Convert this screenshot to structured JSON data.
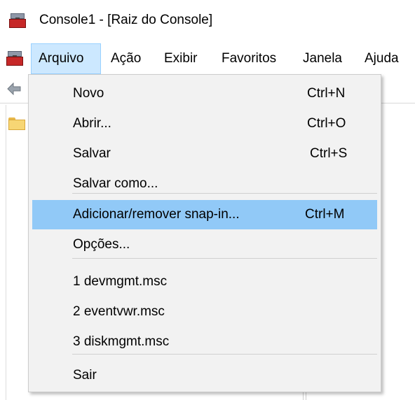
{
  "window": {
    "title": "Console1 - [Raiz do Console]"
  },
  "icons": {
    "app": "toolbox-icon",
    "back": "back-arrow-icon",
    "folder": "folder-icon"
  },
  "menubar": {
    "items": [
      {
        "label": "Arquivo",
        "active": true
      },
      {
        "label": "Ação"
      },
      {
        "label": "Exibir"
      },
      {
        "label": "Favoritos"
      },
      {
        "label": "Janela"
      },
      {
        "label": "Ajuda"
      }
    ]
  },
  "dropdown": {
    "items": [
      {
        "label": "Novo",
        "shortcut": "Ctrl+N"
      },
      {
        "label": "Abrir...",
        "shortcut": "Ctrl+O"
      },
      {
        "label": "Salvar",
        "shortcut": "Ctrl+S"
      },
      {
        "label": "Salvar como...",
        "shortcut": ""
      },
      {
        "label": "Adicionar/remover snap-in...",
        "shortcut": "Ctrl+M",
        "highlighted": true
      },
      {
        "label": "Opções...",
        "shortcut": ""
      },
      {
        "label": "1 devmgmt.msc",
        "shortcut": ""
      },
      {
        "label": "2 eventvwr.msc",
        "shortcut": ""
      },
      {
        "label": "3 diskmgmt.msc",
        "shortcut": ""
      },
      {
        "label": "Sair",
        "shortcut": ""
      }
    ]
  },
  "colors": {
    "highlight": "#91c9f7",
    "menu_active": "#cce8ff",
    "menu_bg": "#f2f2f2"
  }
}
